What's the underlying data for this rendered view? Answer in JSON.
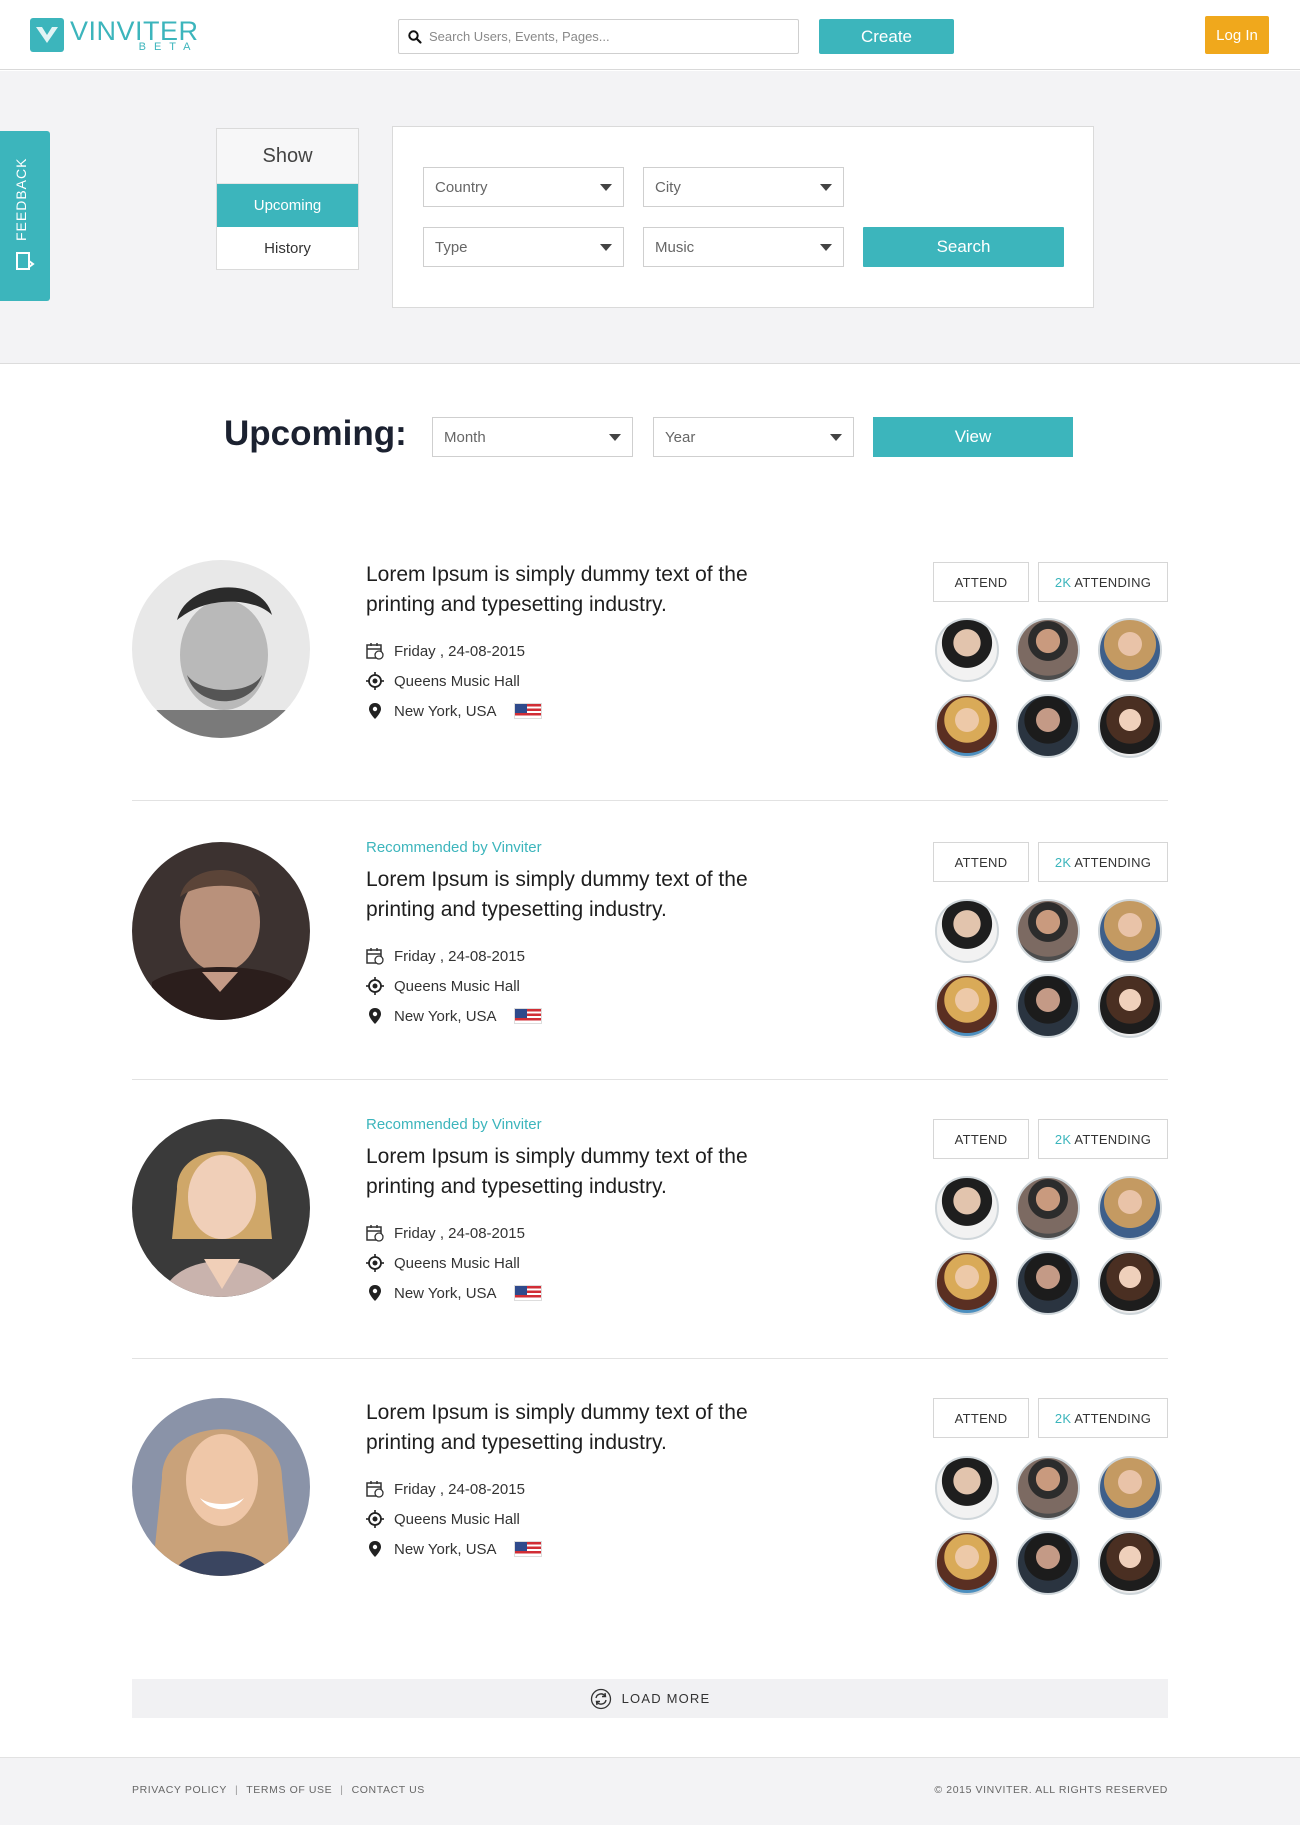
{
  "header": {
    "logo_name": "VINVITER",
    "logo_beta": "BETA",
    "search_placeholder": "Search Users, Events, Pages...",
    "create_label": "Create",
    "login_label": "Log In"
  },
  "feedback": {
    "label": "FEEDBACK"
  },
  "show_panel": {
    "title": "Show",
    "items": [
      {
        "label": "Upcoming",
        "active": true
      },
      {
        "label": "History",
        "active": false
      }
    ]
  },
  "filters": {
    "country": "Country",
    "city": "City",
    "type": "Type",
    "music": "Music",
    "search_label": "Search"
  },
  "upcoming": {
    "title": "Upcoming:",
    "month": "Month",
    "year": "Year",
    "view_label": "View"
  },
  "events": [
    {
      "recommended": "",
      "title": "Lorem Ipsum is simply dummy text of the printing and typesetting industry.",
      "date": "Friday , 24-08-2015",
      "venue": "Queens Music Hall",
      "location": "New York, USA",
      "attend_label": "ATTEND",
      "attending_count": "2K",
      "attending_label": "ATTENDING"
    },
    {
      "recommended": "Recommended by Vinviter",
      "title": "Lorem Ipsum is simply dummy text of the printing and typesetting industry.",
      "date": "Friday , 24-08-2015",
      "venue": "Queens Music Hall",
      "location": "New York, USA",
      "attend_label": "ATTEND",
      "attending_count": "2K",
      "attending_label": "ATTENDING"
    },
    {
      "recommended": "Recommended by Vinviter",
      "title": "Lorem Ipsum is simply dummy text of the printing and typesetting industry.",
      "date": "Friday , 24-08-2015",
      "venue": "Queens Music Hall",
      "location": "New York, USA",
      "attend_label": "ATTEND",
      "attending_count": "2K",
      "attending_label": "ATTENDING"
    },
    {
      "recommended": "",
      "title": "Lorem Ipsum is simply dummy text of the printing and typesetting industry.",
      "date": "Friday , 24-08-2015",
      "venue": "Queens Music Hall",
      "location": "New York, USA",
      "attend_label": "ATTEND",
      "attending_count": "2K",
      "attending_label": "ATTENDING"
    }
  ],
  "load_more": "LOAD MORE",
  "footer": {
    "links": [
      "PRIVACY POLICY",
      "TERMS OF USE",
      "CONTACT US"
    ],
    "copyright": "© 2015 VINVITER. ALL RIGHTS RESERVED"
  },
  "colors": {
    "accent": "#3cb5bc",
    "login": "#f0a81c",
    "heading": "#1b2130"
  },
  "icons": [
    "search-icon",
    "feedback-icon",
    "caret-down-icon",
    "calendar-icon",
    "target-icon",
    "map-pin-icon",
    "us-flag-icon",
    "refresh-icon"
  ]
}
